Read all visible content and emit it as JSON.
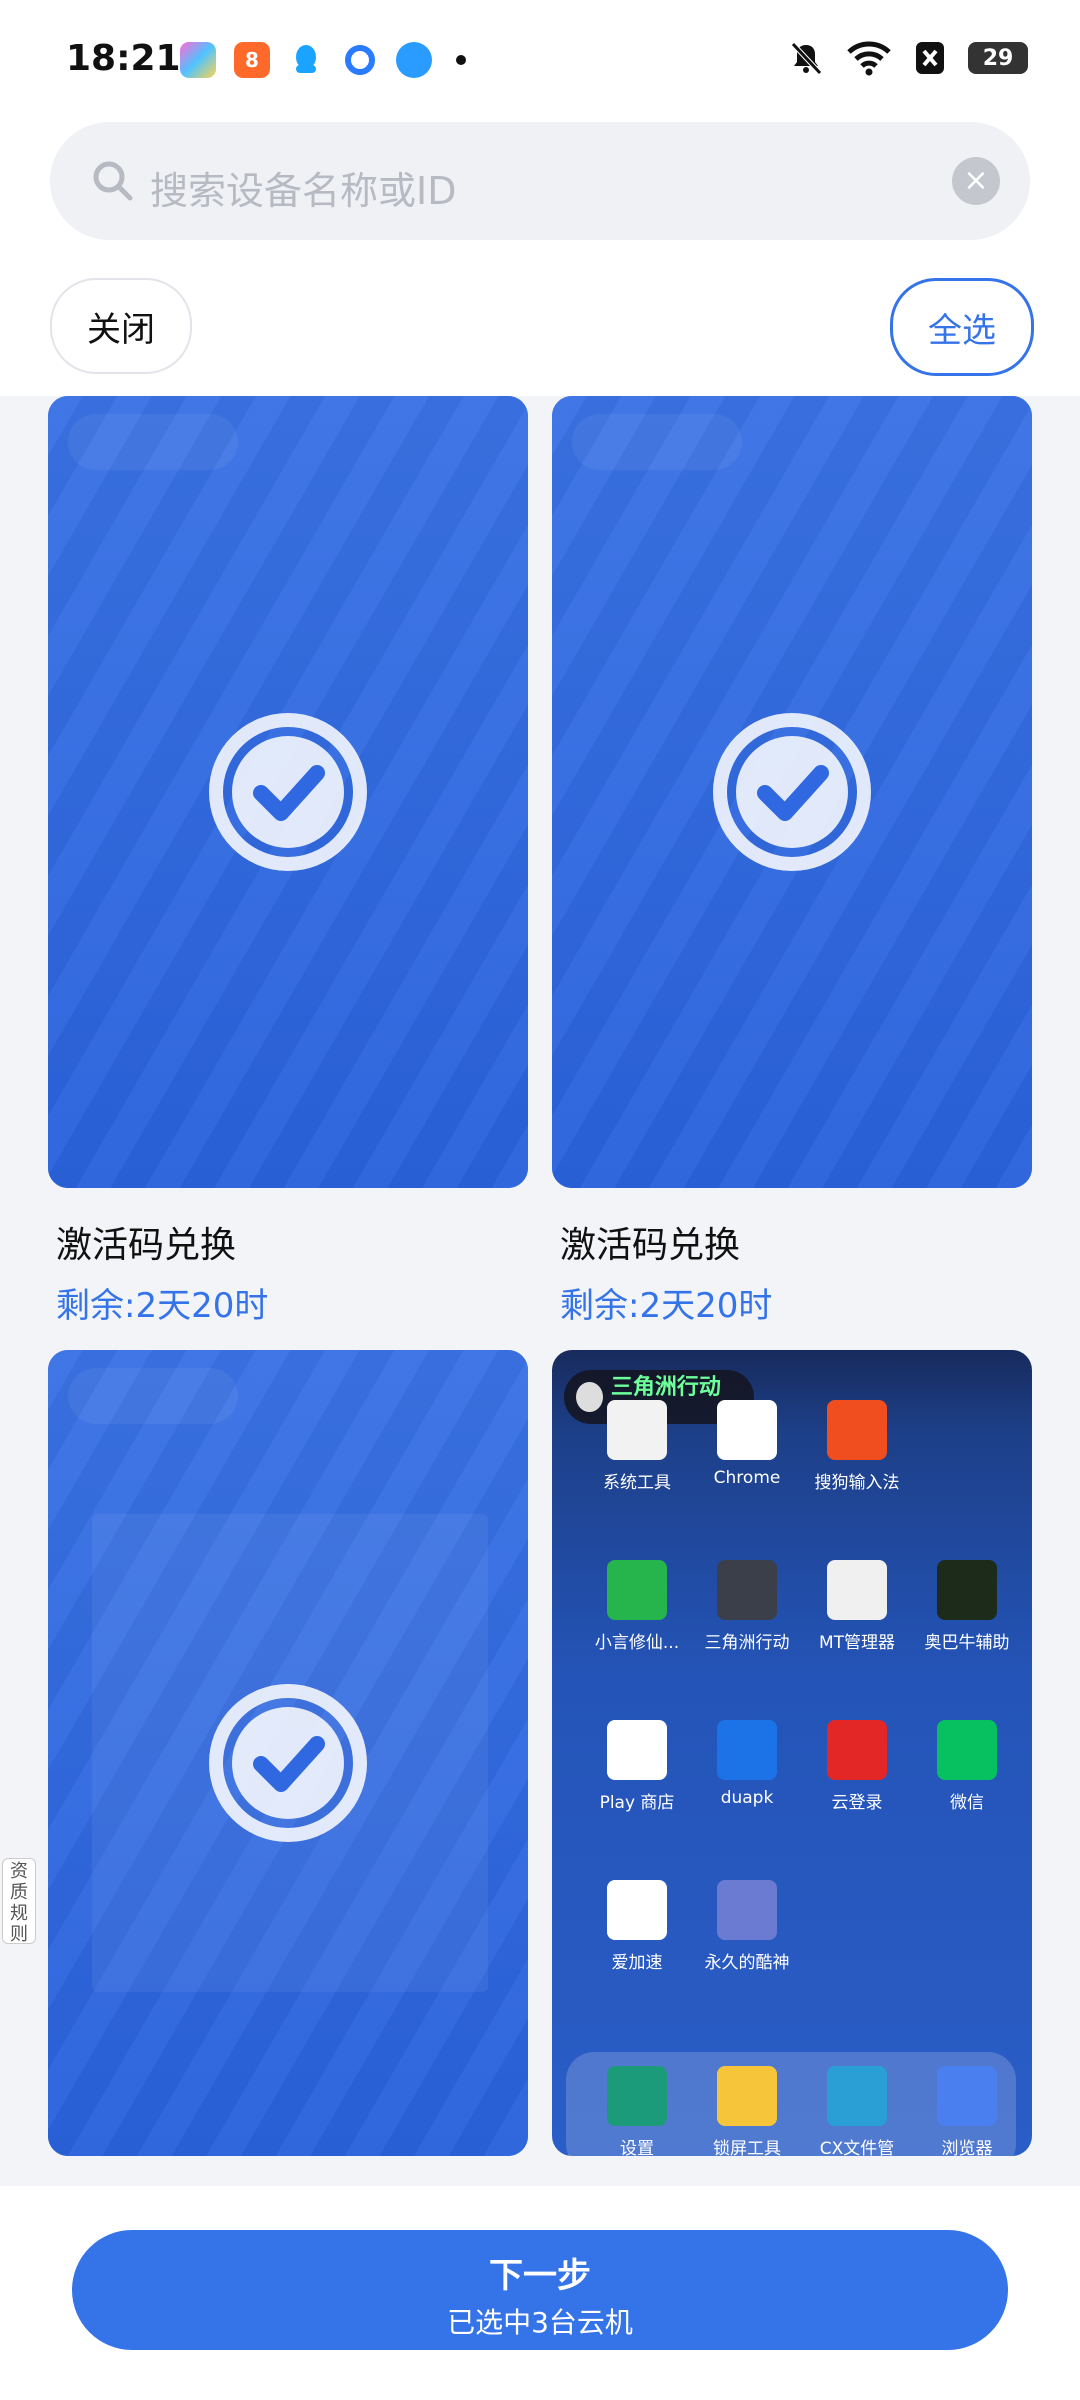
{
  "status_bar": {
    "time": "18:21",
    "battery": "29"
  },
  "search": {
    "placeholder": "搜索设备名称或ID"
  },
  "actions": {
    "close_label": "关闭",
    "select_all_label": "全选"
  },
  "devices": [
    {
      "title": "激活码兑换",
      "remaining": "剩余:2天20时"
    },
    {
      "title": "激活码兑换",
      "remaining": "剩余:2天20时"
    }
  ],
  "remote_screen": {
    "badge": "三角洲行动 Pro",
    "apps": [
      {
        "label": "系统工具",
        "icon": "system-tools-icon",
        "color": "#f2f2f2"
      },
      {
        "label": "Chrome",
        "icon": "chrome-icon",
        "color": "#ffffff"
      },
      {
        "label": "搜狗输入法",
        "icon": "sogou-icon",
        "color": "#f14e20"
      },
      {
        "label": "小言修仙...",
        "icon": "android-icon",
        "color": "#25b54c"
      },
      {
        "label": "三角洲行动",
        "icon": "game-icon",
        "color": "#3b3f4a"
      },
      {
        "label": "MT管理器",
        "icon": "mt-icon",
        "color": "#f0f0f0"
      },
      {
        "label": "奥巴牛辅助",
        "icon": "tree-icon",
        "color": "#1c2b1a"
      },
      {
        "label": "Play 商店",
        "icon": "play-store-icon",
        "color": "#ffffff"
      },
      {
        "label": "duapk",
        "icon": "duapk-icon",
        "color": "#1c73e8"
      },
      {
        "label": "云登录",
        "icon": "cloud-login-icon",
        "color": "#e32626"
      },
      {
        "label": "微信",
        "icon": "wechat-icon",
        "color": "#07c160"
      },
      {
        "label": "爱加速",
        "icon": "accelerate-icon",
        "color": "#ffffff"
      },
      {
        "label": "永久的酷神",
        "icon": "ultraman-icon",
        "color": "#6b7bd1"
      }
    ],
    "dock": [
      {
        "label": "设置",
        "icon": "settings-icon",
        "color": "#1c9b7a"
      },
      {
        "label": "锁屏工具",
        "icon": "toolbox-icon",
        "color": "#f7c53a"
      },
      {
        "label": "CX文件管",
        "icon": "cx-file-icon",
        "color": "#2a9fd6"
      },
      {
        "label": "浏览器",
        "icon": "browser-icon",
        "color": "#4a7ff0"
      }
    ]
  },
  "side_tab": "资质规则",
  "footer": {
    "next_label": "下一步",
    "selected_text": "已选中3台云机"
  }
}
